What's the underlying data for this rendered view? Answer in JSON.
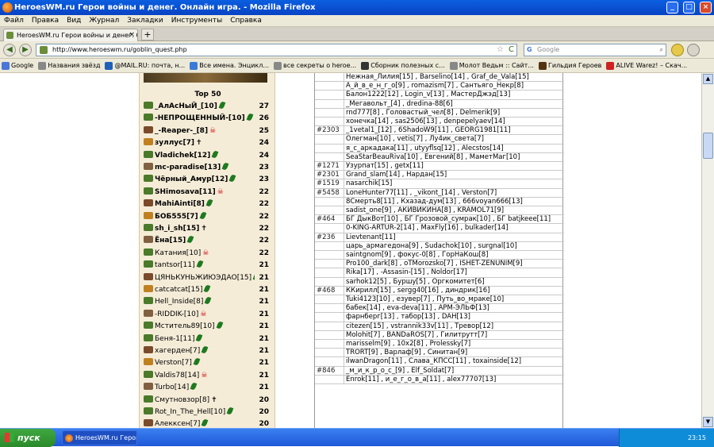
{
  "window": {
    "title": "HeroesWM.ru Герои войны и денег. Онлайн игра. - Mozilla Firefox"
  },
  "menu": [
    "Файл",
    "Правка",
    "Вид",
    "Журнал",
    "Закладки",
    "Инструменты",
    "Справка"
  ],
  "tab": {
    "label": "HeroesWM.ru Герои войны и денег. Онла...",
    "close": "×",
    "new": "+"
  },
  "nav": {
    "back": "◀",
    "forward": "▶",
    "url": "http://www.heroeswm.ru/goblin_quest.php",
    "star": "☆",
    "reload": "C",
    "search_placeholder": "Google",
    "search_engine": "G",
    "search_icon": "⌕"
  },
  "bookmarks": [
    {
      "label": "Google",
      "color": "#4a76d8"
    },
    {
      "label": "Названия звёзд",
      "color": "#888888"
    },
    {
      "label": "@MAIL.RU: почта, н...",
      "color": "#1f5fb8"
    },
    {
      "label": "Все имена. Энцикл...",
      "color": "#3a7ad8"
    },
    {
      "label": "все секреты о heroe...",
      "color": "#888888"
    },
    {
      "label": "Сборник полезных с...",
      "color": "#333333"
    },
    {
      "label": "Молот Ведьм :: Сайт...",
      "color": "#888888"
    },
    {
      "label": "Гильдия Героев",
      "color": "#553311"
    },
    {
      "label": "ALIVE Warez! – Скач...",
      "color": "#cc2222"
    }
  ],
  "left": {
    "heading": "Top 50",
    "rows": [
      {
        "name": "_АлАсНыЙ_[10]",
        "score": "27"
      },
      {
        "name": "-НЕПРОЩЕННЫЙ-[10]",
        "score": "26"
      },
      {
        "name": "_-Reaper-_[8]",
        "score": "25"
      },
      {
        "name": "зуллус[7]",
        "score": "24"
      },
      {
        "name": "Vladichek[12]",
        "score": "24"
      },
      {
        "name": "mc-paradise[13]",
        "score": "23"
      },
      {
        "name": "Чёрный_Амур[12]",
        "score": "23"
      },
      {
        "name": "SHimosava[11]",
        "score": "22"
      },
      {
        "name": "MahiAinti[8]",
        "score": "22"
      },
      {
        "name": "БОБ555[7]",
        "score": "22"
      },
      {
        "name": "sh_i_sh[15]",
        "score": "22"
      },
      {
        "name": "Ёна[15]",
        "score": "22"
      },
      {
        "name": "Катания[10]",
        "score": "22"
      },
      {
        "name": "tantsor[11]",
        "score": "21"
      },
      {
        "name": "ЦЯНЬКУНЬЖИЮЭДАО[15]",
        "score": "21"
      },
      {
        "name": "catcatcat[15]",
        "score": "21"
      },
      {
        "name": "Hell_Inside[8]",
        "score": "21"
      },
      {
        "name": "-RIDDIK-[10]",
        "score": "21"
      },
      {
        "name": "Мститель89[10]",
        "score": "21"
      },
      {
        "name": "Беня-1[11]",
        "score": "21"
      },
      {
        "name": "хагерден[7]",
        "score": "21"
      },
      {
        "name": "Verston[7]",
        "score": "21"
      },
      {
        "name": "Valdis78[14]",
        "score": "21"
      },
      {
        "name": "Turbo[14]",
        "score": "21"
      },
      {
        "name": "Смутновзор[8]",
        "score": "20"
      },
      {
        "name": "Rot_In_The_Hell[10]",
        "score": "20"
      },
      {
        "name": "Алекксен[7]",
        "score": "20"
      }
    ]
  },
  "right": {
    "rows": [
      {
        "id": "",
        "members": "Нежная_Лилия[15] , Barselino[14] , Graf_de_Vala[15]"
      },
      {
        "id": "",
        "members": "А_й_в_е_н_г_о[9] , romazism[7] , Сантьяго_Некр[8]"
      },
      {
        "id": "",
        "members": "Балон1222[12] , Login_v[13] , МастерДжэд[13]"
      },
      {
        "id": "",
        "members": "_Мегавольт_[4] , dredina-88[6]"
      },
      {
        "id": "",
        "members": "rnd777[8] , Головастый_чел[8] , Delmerik[9]"
      },
      {
        "id": "",
        "members": "хонечка[14] , sas2506[13] , denpepelyaev[14]"
      },
      {
        "id": "#2303",
        "members": "_1vetal1_[12] , 6ShadoW9[11] , GEORG1981[11]"
      },
      {
        "id": "",
        "members": "Олегман[10] , vetis[7] , Лу4ик_света[7]"
      },
      {
        "id": "",
        "members": "я_с_аркадака[11] , utyyflsq[12] , Alecstos[14]"
      },
      {
        "id": "",
        "members": "SeaStarBeauRiva[10] , Евгений[8] , МаметМаг[10]"
      },
      {
        "id": "#1271",
        "members": "Узурпат[15] , getx[11]"
      },
      {
        "id": "#2301",
        "members": "Grand_slam[14] , Нардан[15]"
      },
      {
        "id": "#1519",
        "members": "nasarchik[15]"
      },
      {
        "id": "#5458",
        "members": "LoneHunter77[11] , _vikont_[14] , Verston[7]"
      },
      {
        "id": "",
        "members": "8Смерть8[11] , Кхазад-дум[13] , 666voyan666[13]"
      },
      {
        "id": "",
        "members": "sadist_one[9] , АКИВИКИНА[8] , KRAMOL71[9]"
      },
      {
        "id": "#464",
        "members": "БГ ДыкВот[10] , БГ Грозовой_сумрак[10] , БГ batjkeee[11]"
      },
      {
        "id": "",
        "members": "0-KING-ARTUR-2[14] , MaxFly[16] , bulkader[14]"
      },
      {
        "id": "#236",
        "members": "Lievtenant[11]"
      },
      {
        "id": "",
        "members": "царь_армагедона[9] , Sudachok[10] , surgnal[10]"
      },
      {
        "id": "",
        "members": "saintgnom[9] , фокус-0[8] , ГорНаКош[8]"
      },
      {
        "id": "",
        "members": "Pro100_dark[8] , oTMorozsko[7] , ISHET-ZENUNIM[9]"
      },
      {
        "id": "",
        "members": "Rika[17] , -Assasin-[15] , Noldor[17]"
      },
      {
        "id": "",
        "members": "sarhok12[5] , Буршу[5] , Оргкомитет[6]"
      },
      {
        "id": "#468",
        "members": "ККирилл[15] , sergg40[16] , диндрик[16]"
      },
      {
        "id": "",
        "members": "Tuki4123[10] , езувер[7] , Путь_во_мраке[10]"
      },
      {
        "id": "",
        "members": "бабек[14] , eva-deva[11] , АРМ-ЭЛЬФ[13]"
      },
      {
        "id": "",
        "members": "фарнберг[13] , табор[13] , DAH[13]"
      },
      {
        "id": "",
        "members": "citezen[15] , vstrannik33v[11] , Тревор[12]"
      },
      {
        "id": "",
        "members": "Molohit[7] , BANDaROS[7] , Гилитрутт[7]"
      },
      {
        "id": "",
        "members": "marisselm[9] , 10x2[8] , Prolessky[7]"
      },
      {
        "id": "",
        "members": "TRORT[9] , Варлаф[9] , Синитан[9]"
      },
      {
        "id": "",
        "members": "ilwanDragon[11] , Слава_КПСС[11] , toxainside[12]"
      },
      {
        "id": "#846",
        "members": "_м_и_к_р_о_с_[9] , Elf_Soldat[7]"
      },
      {
        "id": "",
        "members": "Enrok[11] , и_е_г_о_в_а[11] , alex77707[13]"
      }
    ]
  },
  "taskbar": {
    "start": "пуск",
    "task": "HeroesWM.ru Герои ...",
    "lang": "RU",
    "time": "23:15"
  }
}
